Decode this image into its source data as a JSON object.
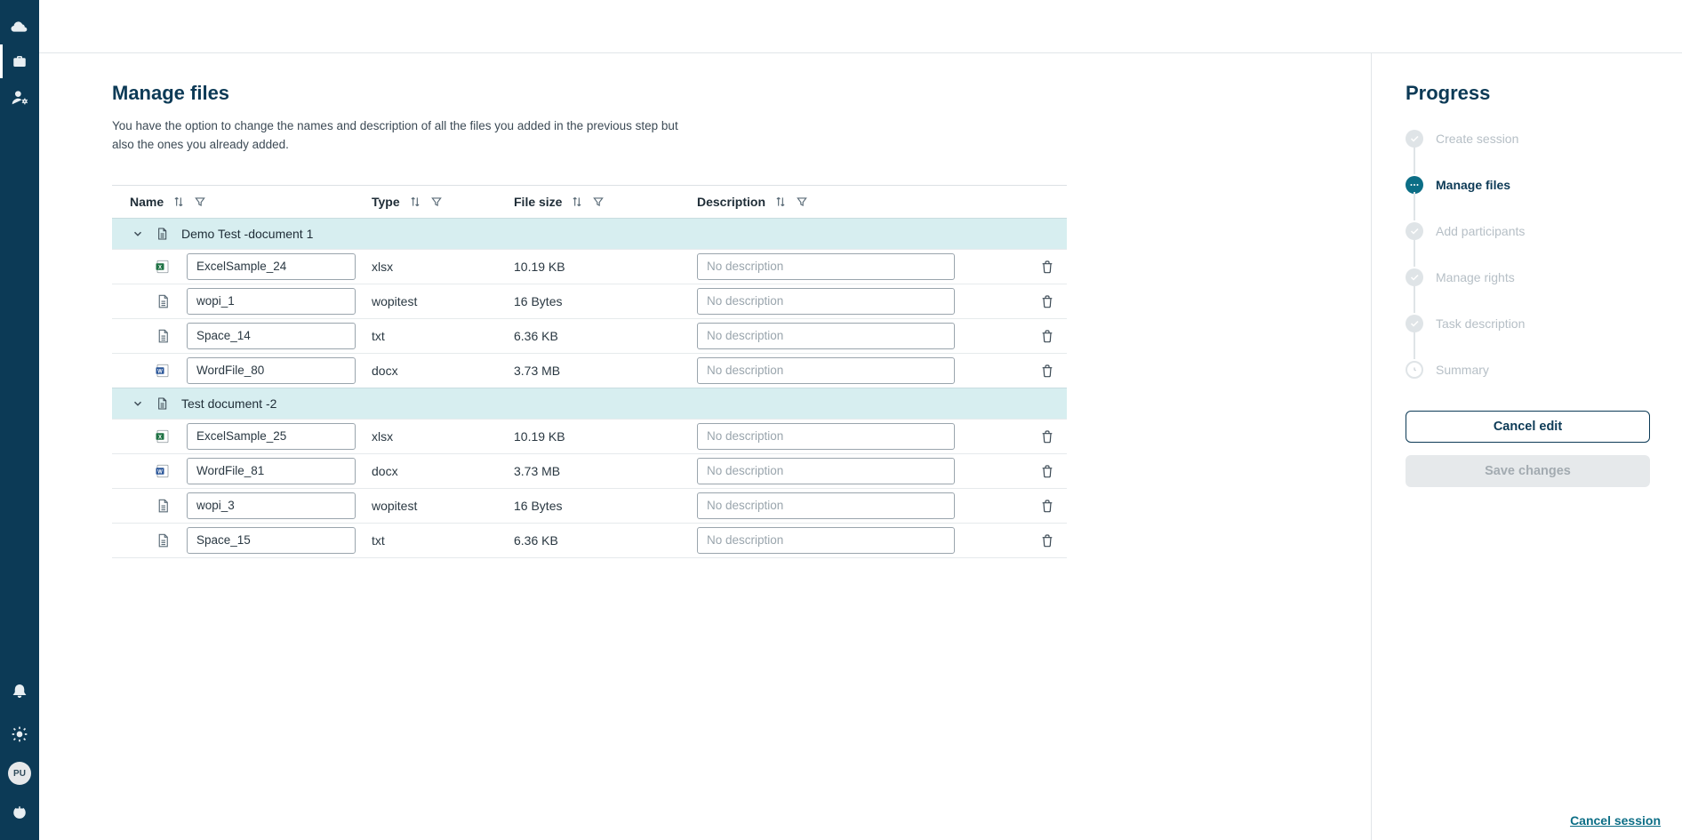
{
  "sidebar": {
    "avatar_initials": "PU"
  },
  "page": {
    "title": "Manage files",
    "description": "You have the option to change the names and description of all the files you added in the previous step but also the ones you already added."
  },
  "table": {
    "headers": {
      "name": "Name",
      "type": "Type",
      "size": "File size",
      "description": "Description"
    },
    "desc_placeholder": "No description",
    "groups": [
      {
        "name": "Demo Test -document 1",
        "files": [
          {
            "icon": "excel",
            "name": "ExcelSample_24",
            "type": "xlsx",
            "size": "10.19 KB",
            "description": ""
          },
          {
            "icon": "doc",
            "name": "wopi_1",
            "type": "wopitest",
            "size": "16 Bytes",
            "description": ""
          },
          {
            "icon": "doc",
            "name": "Space_14",
            "type": "txt",
            "size": "6.36 KB",
            "description": ""
          },
          {
            "icon": "word",
            "name": "WordFile_80",
            "type": "docx",
            "size": "3.73 MB",
            "description": ""
          }
        ]
      },
      {
        "name": "Test document -2",
        "files": [
          {
            "icon": "excel",
            "name": "ExcelSample_25",
            "type": "xlsx",
            "size": "10.19 KB",
            "description": ""
          },
          {
            "icon": "word",
            "name": "WordFile_81",
            "type": "docx",
            "size": "3.73 MB",
            "description": ""
          },
          {
            "icon": "doc",
            "name": "wopi_3",
            "type": "wopitest",
            "size": "16 Bytes",
            "description": ""
          },
          {
            "icon": "doc",
            "name": "Space_15",
            "type": "txt",
            "size": "6.36 KB",
            "description": ""
          }
        ]
      }
    ]
  },
  "progress": {
    "title": "Progress",
    "steps": [
      {
        "label": "Create session",
        "state": "done"
      },
      {
        "label": "Manage files",
        "state": "active"
      },
      {
        "label": "Add participants",
        "state": "done"
      },
      {
        "label": "Manage rights",
        "state": "done"
      },
      {
        "label": "Task description",
        "state": "done"
      },
      {
        "label": "Summary",
        "state": "pending"
      }
    ],
    "cancel_edit": "Cancel edit",
    "save_changes": "Save changes",
    "cancel_session": "Cancel session"
  }
}
